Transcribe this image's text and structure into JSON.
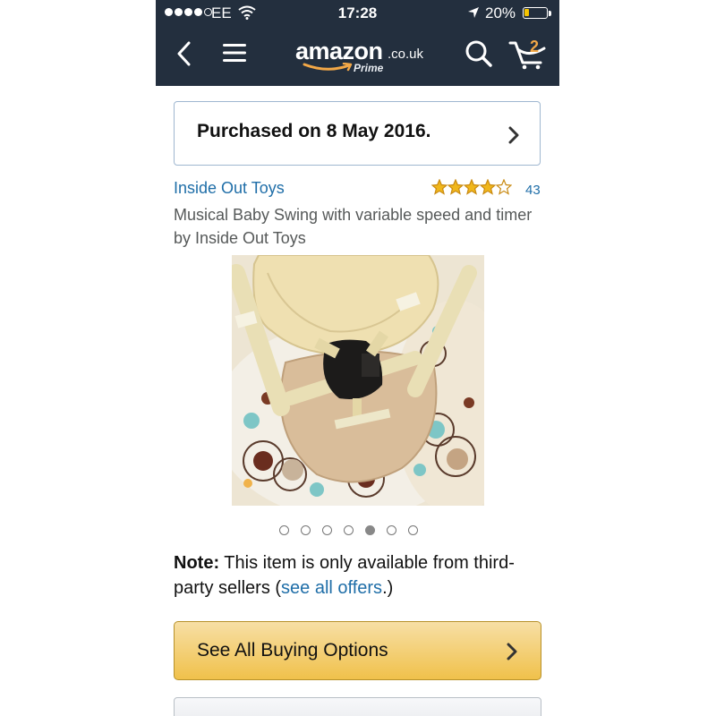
{
  "status_bar": {
    "carrier": "EE",
    "time": "17:28",
    "battery": "20%",
    "battery_level": 0.2
  },
  "header": {
    "back_icon": "chevron-left-icon",
    "menu_icon": "hamburger-menu-icon",
    "logo_word": "amazon",
    "logo_tld": ".co.uk",
    "logo_prime": "Prime",
    "search_icon": "search-icon",
    "cart_count": "2",
    "colors": {
      "bar": "#232f3e",
      "accent": "#f3a847"
    }
  },
  "purchase_banner": {
    "text": "Purchased on 8 May 2016."
  },
  "product": {
    "brand": "Inside Out Toys",
    "rating_stars": 4,
    "rating_count": "43",
    "title": "Musical Baby Swing with variable speed and timer by Inside Out Toys",
    "image_count": 7,
    "active_image_index": 4
  },
  "note": {
    "label": "Note:",
    "text_before": " This item is only available from third-party sellers (",
    "link": "see all offers",
    "text_after": ".)"
  },
  "buy_button": {
    "label": "See All Buying Options"
  }
}
